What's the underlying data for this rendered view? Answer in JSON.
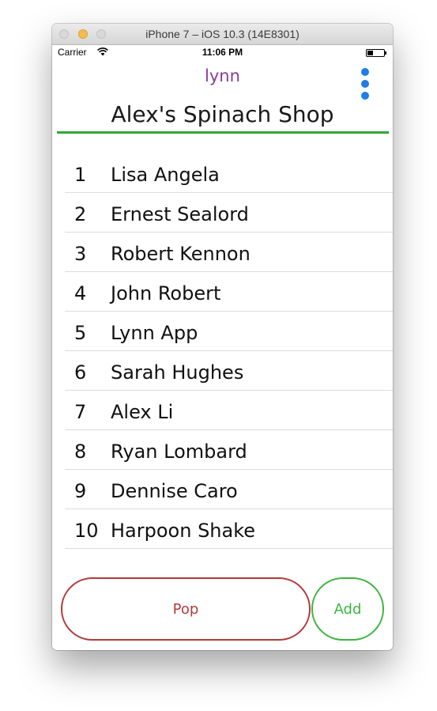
{
  "window": {
    "title": "iPhone 7 – iOS 10.3 (14E8301)"
  },
  "status_bar": {
    "carrier": "Carrier",
    "time": "11:06 PM",
    "icons": [
      "wifi-icon",
      "battery-icon"
    ]
  },
  "nav": {
    "app_name": "lynn",
    "menu_icon": "more-vertical-icon",
    "menu_color": "#1f7de3",
    "app_name_color": "#8a3aa0"
  },
  "header": {
    "title": "Alex's Spinach Shop",
    "divider_color": "#2fa836"
  },
  "queue": [
    {
      "number": "1",
      "name": "Lisa Angela"
    },
    {
      "number": "2",
      "name": "Ernest Sealord"
    },
    {
      "number": "3",
      "name": "Robert Kennon"
    },
    {
      "number": "4",
      "name": "John Robert"
    },
    {
      "number": "5",
      "name": "Lynn App"
    },
    {
      "number": "6",
      "name": "Sarah Hughes"
    },
    {
      "number": "7",
      "name": "Alex Li"
    },
    {
      "number": "8",
      "name": "Ryan Lombard"
    },
    {
      "number": "9",
      "name": "Dennise Caro"
    },
    {
      "number": "10",
      "name": "Harpoon Shake"
    }
  ],
  "actions": {
    "pop_label": "Pop",
    "pop_color": "#b23a3a",
    "add_label": "Add",
    "add_color": "#3ab53f"
  }
}
